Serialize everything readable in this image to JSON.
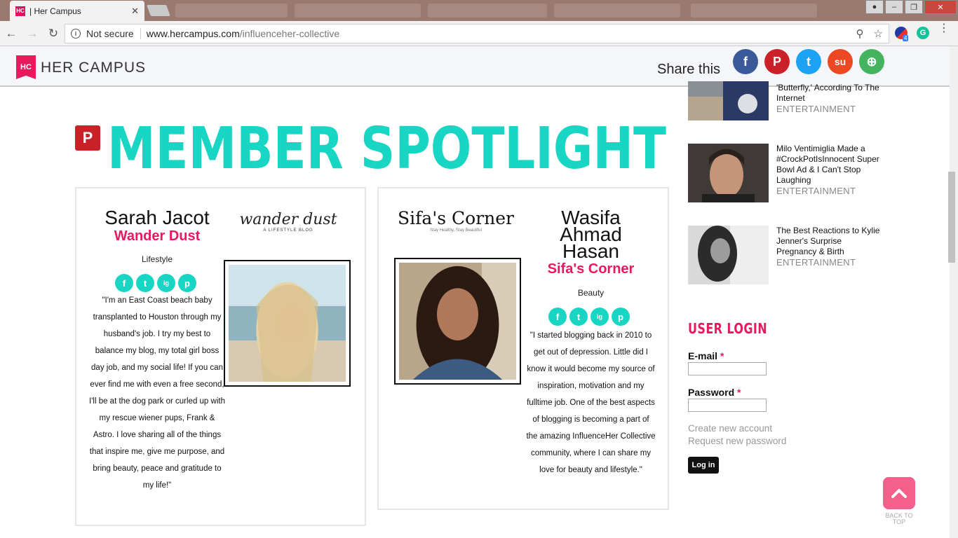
{
  "browser": {
    "tab_title": "| Her Campus",
    "tab_favicon": "HC",
    "close_tab_glyph": "✕",
    "not_secure": "Not secure",
    "url_host": "www.hercampus.com",
    "url_path": "/influenceher-collective",
    "extension_badge": "4"
  },
  "header": {
    "logo_mark": "HC",
    "logo_text": "HER CAMPUS",
    "share_label": "Share this",
    "share_buttons": [
      {
        "name": "facebook",
        "glyph": "f",
        "color": "#3b5998"
      },
      {
        "name": "pinterest",
        "glyph": "P",
        "color": "#cb2027"
      },
      {
        "name": "twitter",
        "glyph": "t",
        "color": "#1da1f2"
      },
      {
        "name": "stumbleupon",
        "glyph": "su",
        "color": "#eb4823"
      },
      {
        "name": "more",
        "glyph": "⊕",
        "color": "#44b35e"
      }
    ]
  },
  "main": {
    "pin_badge": "P",
    "title": "MEMBER SPOTLIGHT",
    "members": [
      {
        "name": "Sarah Jacot",
        "blog": "Wander Dust",
        "blog_logo": "wander dust",
        "blog_logo_sub": "A LIFESTYLE BLOG",
        "category": "Lifestyle",
        "quote": "\"I'm an East Coast beach baby transplanted to Houston through my husband's job. I try my best to balance my blog, my total girl boss day job, and my social life! If you can ever find me with even a free second, I'll be at the dog park or curled up with my rescue wiener pups, Frank & Astro. I love sharing all of the things that inspire me, give me purpose, and bring beauty, peace and gratitude to my life!\""
      },
      {
        "name": "Wasifa Ahmad Hasan",
        "name_lines": [
          "Wasifa",
          "Ahmad",
          "Hasan"
        ],
        "blog": "Sifa's Corner",
        "blog_logo": "Sifa's Corner",
        "blog_logo_sub": "Stay Healthy, Stay Beautiful",
        "category": "Beauty",
        "quote": "\"I started blogging back in 2010 to get out of depression. Little did I know it would become my source of inspiration, motivation and my fulltime job. One of the best aspects of blogging is becoming a part of the amazing InfluenceHer Collective community, where I can share my love for beauty and lifestyle.\""
      }
    ],
    "social_icons": [
      "f",
      "t",
      "ig",
      "p"
    ]
  },
  "sidebar": {
    "articles": [
      {
        "title": "'Butterfly,' According To The Internet",
        "category": "ENTERTAINMENT"
      },
      {
        "title": "Milo Ventimiglia Made a #CrockPotIsInnocent Super Bowl Ad & I Can't Stop Laughing",
        "category": "ENTERTAINMENT"
      },
      {
        "title": "The Best Reactions to Kylie Jenner's Surprise Pregnancy & Birth",
        "category": "ENTERTAINMENT"
      }
    ],
    "login": {
      "title": "USER LOGIN",
      "email_label": "E-mail",
      "password_label": "Password",
      "required_mark": "*",
      "create_account": "Create new account",
      "request_password": "Request new password",
      "login_button": "Log in"
    },
    "back_to_top": "BACK TO TOP"
  }
}
